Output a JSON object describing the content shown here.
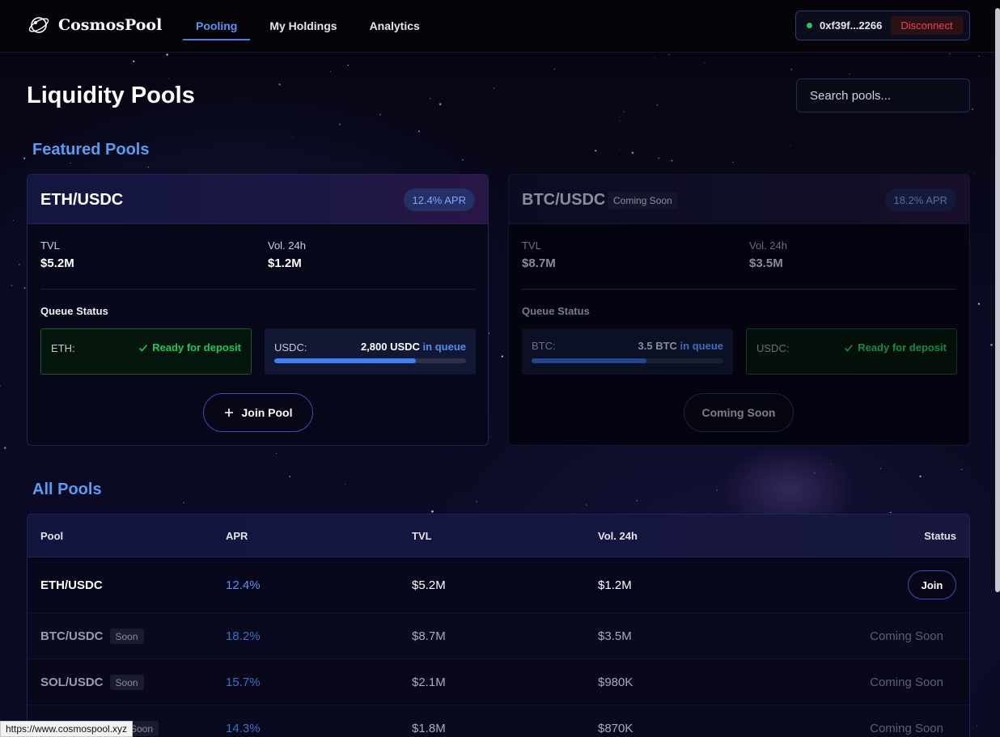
{
  "app": {
    "name": "CosmosPool",
    "logo_icon": "planet-ring-icon"
  },
  "nav": {
    "items": [
      {
        "label": "Pooling",
        "active": true
      },
      {
        "label": "My Holdings",
        "active": false
      },
      {
        "label": "Analytics",
        "active": false
      }
    ]
  },
  "wallet": {
    "address": "0xf39f...2266",
    "status_color": "#22c55e",
    "disconnect_label": "Disconnect"
  },
  "page": {
    "title": "Liquidity Pools",
    "search_placeholder": "Search pools..."
  },
  "featured": {
    "title": "Featured Pools",
    "cards": [
      {
        "pair": "ETH/USDC",
        "apr": "12.4% APR",
        "tvl_label": "TVL",
        "tvl": "$5.2M",
        "vol_label": "Vol. 24h",
        "vol": "$1.2M",
        "queue_label": "Queue Status",
        "queue_left": {
          "asset": "ETH:",
          "status": "Ready for deposit"
        },
        "queue_right": {
          "asset": "USDC:",
          "amount": "2,800 USDC",
          "suffix": "in queue",
          "progress_percent": 74
        },
        "action_label": "Join Pool"
      },
      {
        "pair": "BTC/USDC",
        "badge": "Coming Soon",
        "apr": "18.2% APR",
        "tvl_label": "TVL",
        "tvl": "$8.7M",
        "vol_label": "Vol. 24h",
        "vol": "$3.5M",
        "queue_label": "Queue Status",
        "queue_left": {
          "asset": "BTC:",
          "amount": "3.5 BTC",
          "suffix": "in queue",
          "progress_percent": 60
        },
        "queue_right": {
          "asset": "USDC:",
          "status": "Ready for deposit"
        },
        "action_label": "Coming Soon"
      }
    ]
  },
  "all_pools": {
    "title": "All Pools",
    "columns": [
      "Pool",
      "APR",
      "TVL",
      "Vol. 24h",
      "Status"
    ],
    "rows": [
      {
        "pool": "ETH/USDC",
        "badge": "",
        "apr": "12.4%",
        "tvl": "$5.2M",
        "vol": "$1.2M",
        "status": "Join"
      },
      {
        "pool": "BTC/USDC",
        "badge": "Soon",
        "apr": "18.2%",
        "tvl": "$8.7M",
        "vol": "$3.5M",
        "status": "Coming Soon"
      },
      {
        "pool": "SOL/USDC",
        "badge": "Soon",
        "apr": "15.7%",
        "tvl": "$2.1M",
        "vol": "$980K",
        "status": "Coming Soon"
      },
      {
        "pool": "",
        "badge": "Soon",
        "apr": "14.3%",
        "tvl": "$1.8M",
        "vol": "$870K",
        "status": "Coming Soon"
      }
    ]
  },
  "browser": {
    "status_url": "https://www.cosmospool.xyz"
  }
}
